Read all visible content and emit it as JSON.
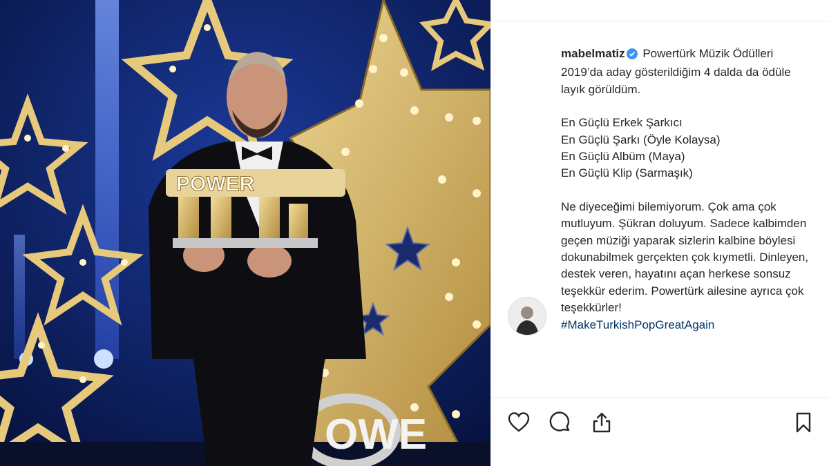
{
  "post": {
    "username": "mabelmatiz",
    "verified_icon": "verified-badge-icon",
    "caption_intro": "Powertürk Müzik Ödülleri 2019’da aday gösterildiğim 4 dalda da ödüle layık görüldüm.",
    "awards": [
      "En Güçlü Erkek Şarkıcı",
      "En Güçlü Şarkı (Öyle Kolaysa)",
      "En Güçlü Albüm (Maya)",
      "En Güçlü Klip (Sarmaşık)"
    ],
    "caption_body": "Ne diyeceğimi bilemiyorum. Çok ama çok mutluyum. Şükran doluyum. Sadece kalbimden geçen müziği yaparak sizlerin kalbine böylesi dokunabilmek gerçekten çok kıymetli. Dinleyen, destek veren, hayatını açan herkese sonsuz teşekkür ederim. Powertürk ailesine ayrıca çok teşekkürler!",
    "hashtag": "#MakeTurkishPopGreatAgain"
  },
  "photo": {
    "stage_logo_text": "OWE",
    "trophy_text": "POWER"
  },
  "actions": {
    "like_icon": "heart-icon",
    "comment_icon": "comment-icon",
    "share_icon": "share-icon",
    "save_icon": "bookmark-icon"
  },
  "colors": {
    "stage_background": "#0a1a56",
    "marquee_gold": "#d9b86a",
    "verified_blue": "#3897f0",
    "text": "#262626",
    "hashtag": "#00376b"
  }
}
